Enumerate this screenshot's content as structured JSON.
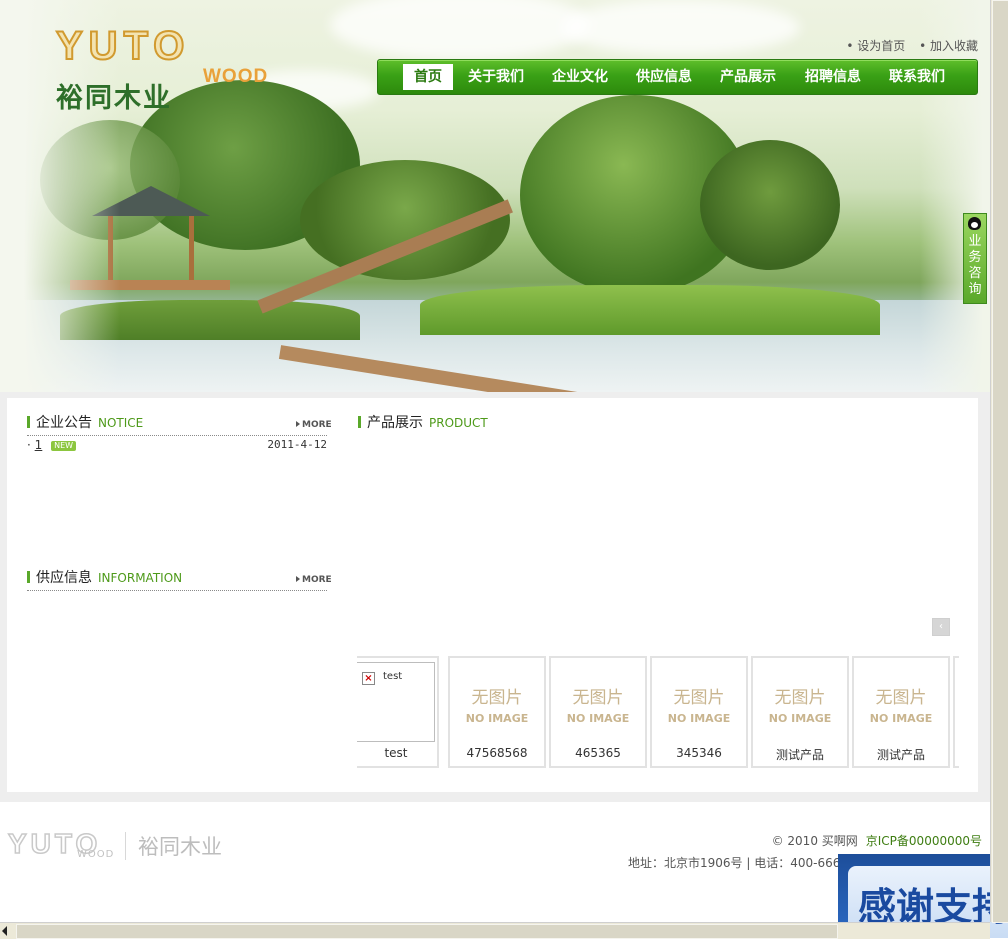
{
  "header": {
    "logo_en": "YUTO",
    "logo_wood": "WOOD",
    "logo_cn": "裕同木业",
    "top_links": [
      "• 设为首页",
      "• 加入收藏"
    ]
  },
  "nav": {
    "items": [
      "首页",
      "关于我们",
      "企业文化",
      "供应信息",
      "产品展示",
      "招聘信息",
      "联系我们"
    ],
    "active": "首页"
  },
  "qq_widget": {
    "label": "业务咨询"
  },
  "notice": {
    "title_cn": "企业公告",
    "title_en": "NOTICE",
    "more": "MORE",
    "items": [
      {
        "bullet": "·",
        "link": "1",
        "badge": "NEW",
        "date": "2011-4-12"
      }
    ]
  },
  "supply": {
    "title_cn": "供应信息",
    "title_en": "INFORMATION",
    "more": "MORE"
  },
  "products": {
    "title_cn": "产品展示",
    "title_en": "PRODUCT",
    "scroll_icon": "‹",
    "first": {
      "alt": "test",
      "caption": "test"
    },
    "placeholder_cn": "无图片",
    "placeholder_en": "NO IMAGE",
    "items": [
      {
        "caption": "47568568"
      },
      {
        "caption": "465365"
      },
      {
        "caption": "345346"
      },
      {
        "caption": "测试产品"
      },
      {
        "caption": "测试产品"
      }
    ]
  },
  "footer": {
    "logo_en": "YUTO",
    "logo_wood": "WOOD",
    "logo_cn": "裕同木业",
    "copyright": "© 2010 买啊网",
    "icp": "京ICP备00000000号",
    "address": "地址：北京市1906号 | 电话：400-666"
  },
  "popup": {
    "text": "感谢支持"
  },
  "colors": {
    "nav_green": "#3aa116",
    "accent_green": "#4e9a1a",
    "placeholder_tan": "#c9b58f"
  }
}
